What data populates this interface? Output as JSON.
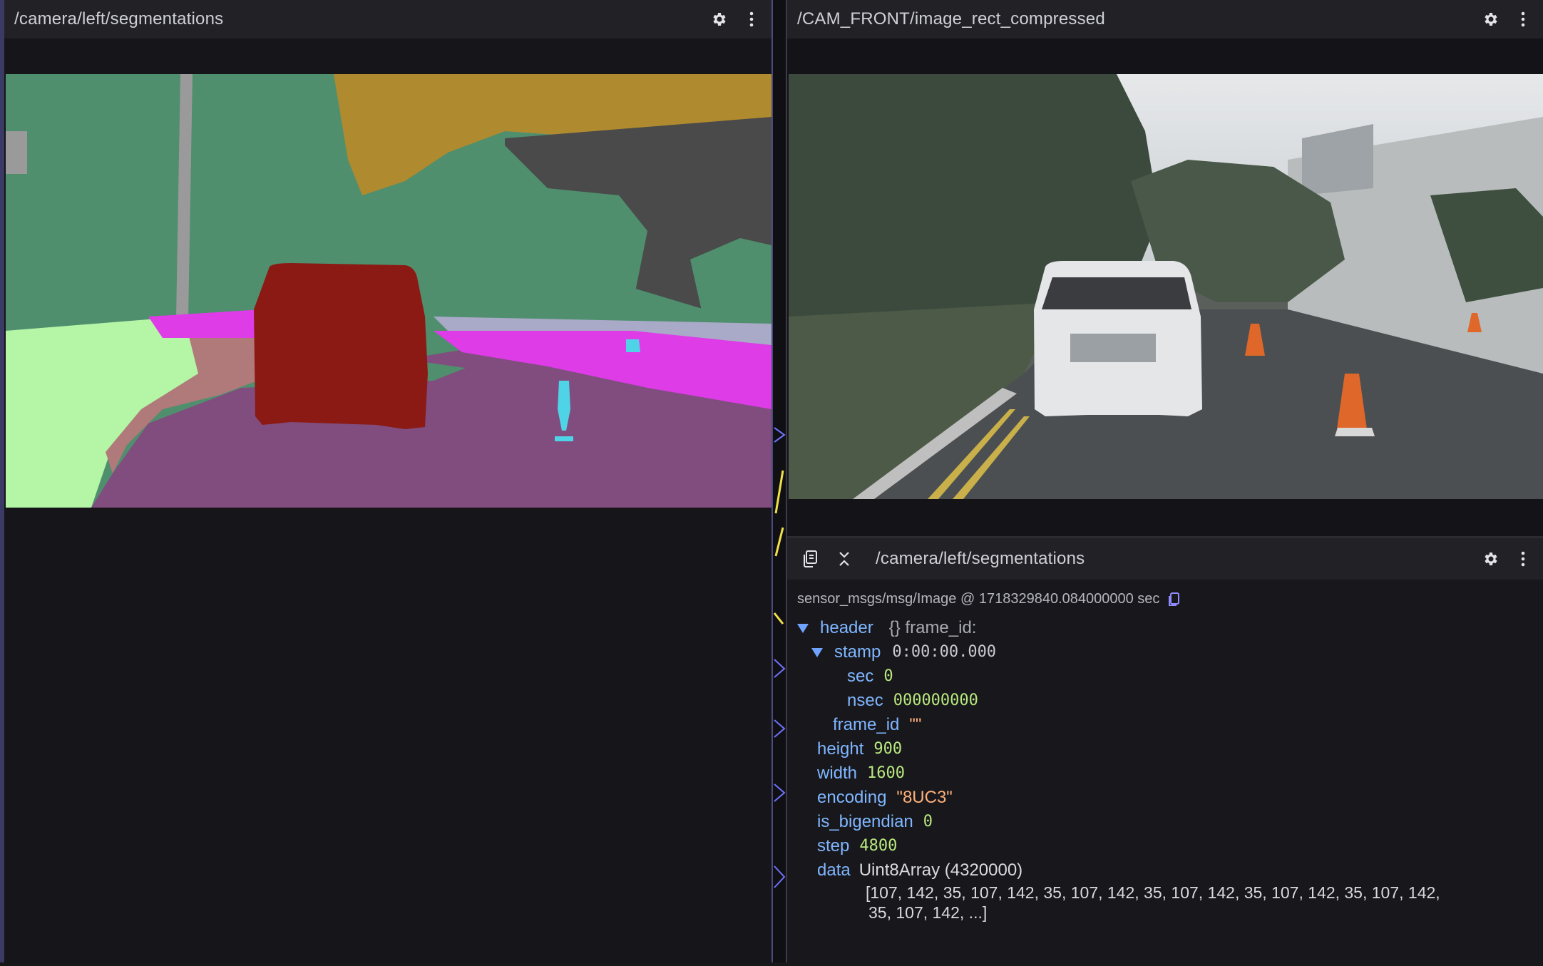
{
  "left_panel": {
    "title": "/camera/left/segmentations",
    "icons": [
      "gear-icon",
      "more-vertical-icon"
    ]
  },
  "camera_panel": {
    "title": "/CAM_FRONT/image_rect_compressed",
    "icons": [
      "gear-icon",
      "more-vertical-icon"
    ]
  },
  "message_panel": {
    "title": "/camera/left/segmentations",
    "icons_left": [
      "copy-icon",
      "collapse-icon"
    ],
    "icons_right": [
      "gear-icon",
      "more-vertical-icon"
    ],
    "meta": "sensor_msgs/msg/Image @ 1718329840.084000000 sec",
    "tree": {
      "header_key": "header",
      "header_summary": "{} frame_id:",
      "stamp_key": "stamp",
      "stamp_value": "0:00:00.000",
      "sec_key": "sec",
      "sec_value": "0",
      "nsec_key": "nsec",
      "nsec_value": "000000000",
      "frame_id_key": "frame_id",
      "frame_id_value": "\"\"",
      "height_key": "height",
      "height_value": "900",
      "width_key": "width",
      "width_value": "1600",
      "encoding_key": "encoding",
      "encoding_value": "\"8UC3\"",
      "is_bigendian_key": "is_bigendian",
      "is_bigendian_value": "0",
      "step_key": "step",
      "step_value": "4800",
      "data_key": "data",
      "data_type": "Uint8Array (4320000)",
      "data_line1": "[107, 142, 35, 107, 142, 35, 107, 142, 35, 107, 142, 35, 107, 142, 35, 107, 142,",
      "data_line2": "35, 107, 142, ...]"
    }
  },
  "colors": {
    "accent": "#6fa3ff",
    "key": "#7fb6ff",
    "number": "#b9e87e",
    "string": "#ffb07a",
    "panel_header": "#222226"
  }
}
